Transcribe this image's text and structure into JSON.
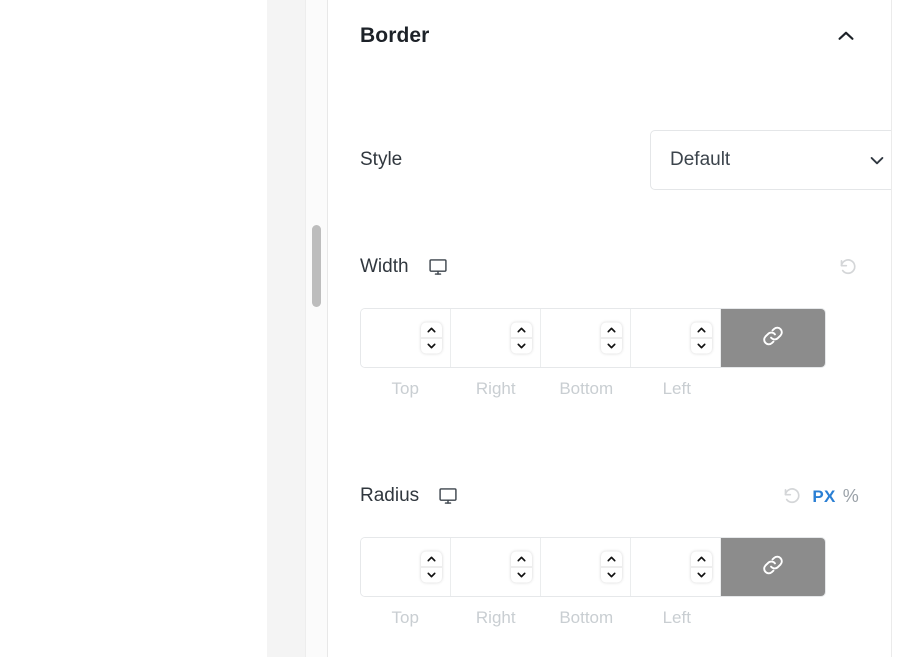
{
  "panel": {
    "section_title": "Border",
    "collapse_icon": "chevron-up-icon"
  },
  "style": {
    "label": "Style",
    "selected": "Default",
    "chevron_icon": "chevron-down-icon",
    "options": [
      "Default"
    ]
  },
  "width": {
    "label": "Width",
    "device_icon": "desktop-monitor-icon",
    "reset_icon": "reset-icon",
    "values": [
      "",
      "",
      "",
      ""
    ],
    "placeholders": [
      "",
      "",
      "",
      ""
    ],
    "side_labels": [
      "Top",
      "Right",
      "Bottom",
      "Left"
    ],
    "link_icon": "link-chain-icon",
    "linked": true
  },
  "radius": {
    "label": "Radius",
    "device_icon": "desktop-monitor-icon",
    "reset_icon": "reset-icon",
    "unit_px": "PX",
    "unit_percent": "%",
    "active_unit": "PX",
    "values": [
      "",
      "",
      "",
      ""
    ],
    "placeholders": [
      "",
      "",
      "",
      ""
    ],
    "side_labels": [
      "Top",
      "Right",
      "Bottom",
      "Left"
    ],
    "link_icon": "link-chain-icon",
    "linked": true
  },
  "colors": {
    "accent": "#2a7fd4",
    "link_button_bg": "#8c8c8c",
    "label_muted": "#c9ced2",
    "text_primary": "#1d2228",
    "scrollbar_thumb": "#bdbdbd"
  }
}
